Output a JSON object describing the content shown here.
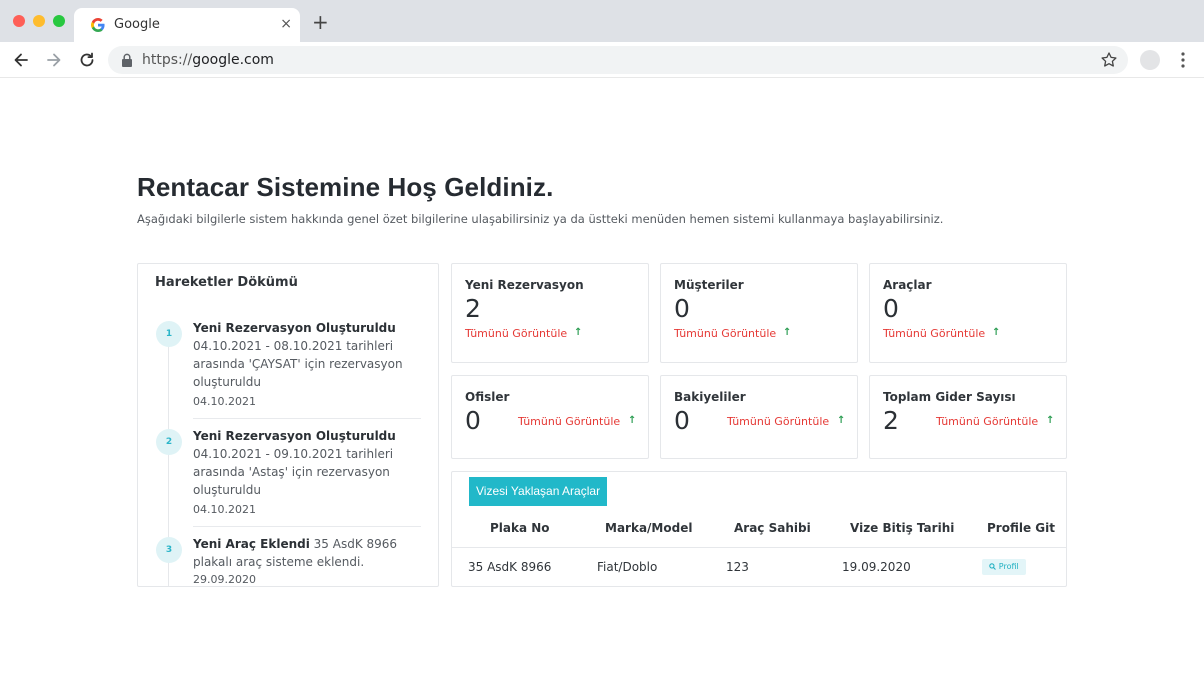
{
  "browser": {
    "tab_title": "Google",
    "tab_close": "×",
    "new_tab": "+",
    "url_scheme": "https://",
    "url_host": "google.com"
  },
  "page": {
    "title": "Rentacar Sistemine Hoş Geldiniz.",
    "subtitle": "Aşağıdaki bilgilerle sistem hakkında genel özet bilgilerine ulaşabilirsiniz ya da üstteki menüden hemen sistemi kullanmaya başlayabilirsiniz."
  },
  "timeline": {
    "title": "Hareketler Dökümü",
    "items": [
      {
        "number": "1",
        "heading": "Yeni Rezervasyon Oluşturuldu",
        "text": "04.10.2021 - 08.10.2021 tarihleri arasında 'ÇAYSAT' için rezervasyon oluşturuldu",
        "date": "04.10.2021"
      },
      {
        "number": "2",
        "heading": "Yeni Rezervasyon Oluşturuldu",
        "text": "04.10.2021 - 09.10.2021 tarihleri arasında 'Astaş' için rezervasyon oluşturuldu",
        "date": "04.10.2021"
      },
      {
        "number": "3",
        "heading": "Yeni Araç Eklendi",
        "text": "35 AsdK 8966 plakalı araç sisteme eklendi.",
        "date": "29.09.2020"
      }
    ]
  },
  "stats": {
    "link_label": "Tümünü Görüntüle",
    "arrow": "↑",
    "cards": [
      {
        "label": "Yeni Rezervasyon",
        "value": "2"
      },
      {
        "label": "Müşteriler",
        "value": "0"
      },
      {
        "label": "Araçlar",
        "value": "0"
      },
      {
        "label": "Ofisler",
        "value": "0"
      },
      {
        "label": "Bakiyeliler",
        "value": "0"
      },
      {
        "label": "Toplam Gider Sayısı",
        "value": "2"
      }
    ]
  },
  "vehicles": {
    "button_label": "Vizesi Yaklaşan Araçlar",
    "columns": [
      "Plaka No",
      "Marka/Model",
      "Araç Sahibi",
      "Vize Bitiş Tarihi",
      "Profile Git"
    ],
    "rows": [
      {
        "plate": "35 AsdK 8966",
        "model": "Fiat/Doblo",
        "owner": "123",
        "expiry": "19.09.2020",
        "profile_label": "Profil"
      }
    ]
  },
  "colors": {
    "accent": "#21b8c9",
    "link": "#e53935",
    "up_arrow": "#2e9e54"
  }
}
